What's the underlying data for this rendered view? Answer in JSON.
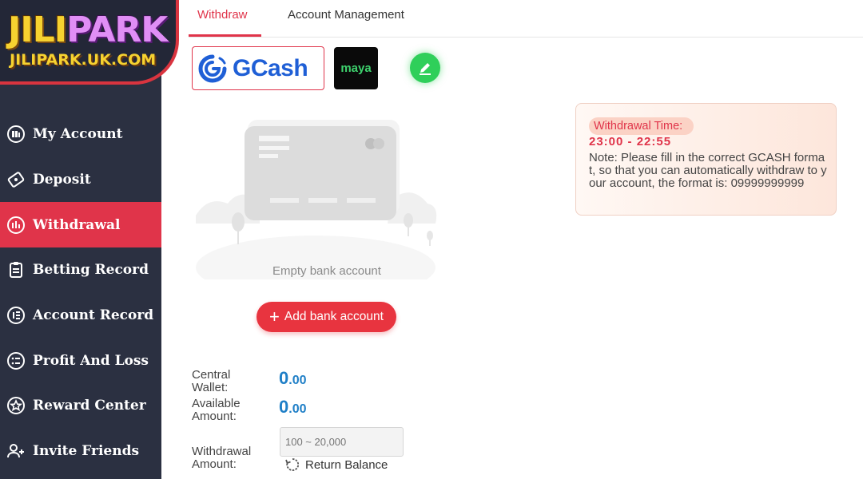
{
  "logo": {
    "part1": "JILI",
    "part2": "PARK",
    "subtitle": "JILIPARK.UK.COM"
  },
  "sidebar": {
    "items": [
      {
        "label": "My Account",
        "icon": "account-icon",
        "active": false
      },
      {
        "label": "Deposit",
        "icon": "deposit-icon",
        "active": false
      },
      {
        "label": "Withdrawal",
        "icon": "withdrawal-icon",
        "active": true
      },
      {
        "label": "Betting Record",
        "icon": "betting-record-icon",
        "active": false
      },
      {
        "label": "Account Record",
        "icon": "account-record-icon",
        "active": false
      },
      {
        "label": "Profit And Loss",
        "icon": "profit-loss-icon",
        "active": false
      },
      {
        "label": "Reward Center",
        "icon": "reward-center-icon",
        "active": false
      },
      {
        "label": "Invite Friends",
        "icon": "invite-friends-icon",
        "active": false
      }
    ]
  },
  "tabs": [
    {
      "label": "Withdraw",
      "active": true
    },
    {
      "label": "Account Management",
      "active": false
    }
  ],
  "wallets": {
    "gcash": "GCash",
    "maya": "maya"
  },
  "bank": {
    "empty_text": "Empty bank account",
    "add_label": "Add bank account"
  },
  "form": {
    "central_wallet_label_1": "Central",
    "central_wallet_label_2": "Wallet:",
    "central_wallet_int": "0",
    "central_wallet_dec": ".00",
    "available_label_1": "Available",
    "available_label_2": "Amount:",
    "available_int": "0",
    "available_dec": ".00",
    "withdrawal_label_1": "Withdrawal",
    "withdrawal_label_2": "Amount:",
    "amount_placeholder": "100 ~ 20,000",
    "return_balance": "Return Balance"
  },
  "notice": {
    "title": "Withdrawal Time:",
    "time": "23:00  - 22:55",
    "note": "Note: Please fill in the correct GCASH format, so that you can automatically withdraw to your account, the format is: 09999999999"
  },
  "colors": {
    "accent": "#e0344a",
    "sidebar": "#2b3041",
    "value_blue": "#1f7fc7",
    "gcash_blue": "#1f5fd6",
    "edit_green": "#2fcf5a"
  }
}
